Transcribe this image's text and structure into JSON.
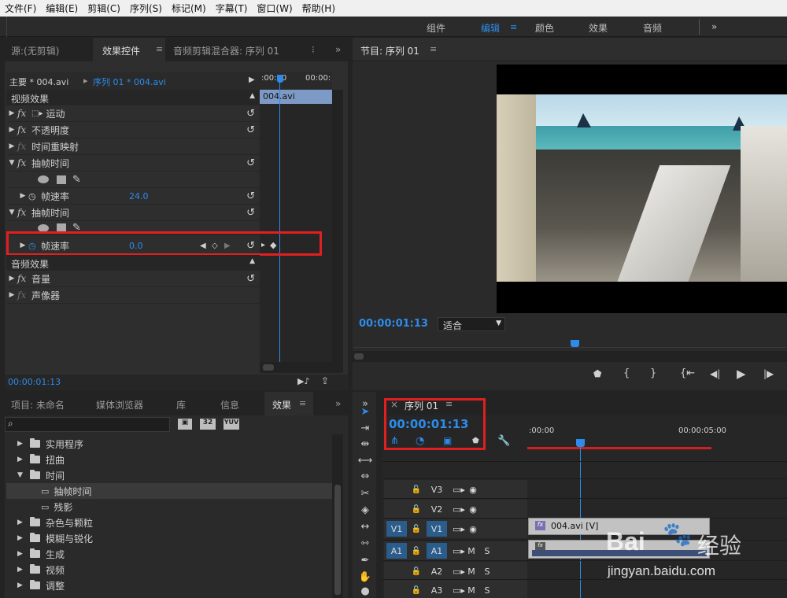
{
  "menu": [
    "文件(F)",
    "编辑(E)",
    "剪辑(C)",
    "序列(S)",
    "标记(M)",
    "字幕(T)",
    "窗口(W)",
    "帮助(H)"
  ],
  "workspaces": {
    "items": [
      "组件",
      "编辑",
      "颜色",
      "效果",
      "音频"
    ],
    "active": "编辑",
    "more": "»"
  },
  "effect_panel": {
    "tabs": [
      "源:(无剪辑)",
      "效果控件",
      "音频剪辑混合器: 序列 01"
    ],
    "master": "主要 * 004.avi",
    "sequence": "序列 01 * 004.avi",
    "ruler": [
      ":00:00",
      "00:00:"
    ],
    "clip_label": "004.avi",
    "video_section": "视频效果",
    "audio_section": "音频效果",
    "rows": {
      "motion": "运动",
      "opacity": "不透明度",
      "time_remap": "时间重映射",
      "posterize1": "抽帧时间",
      "framerate1": "帧速率",
      "framerate1_value": "24.0",
      "posterize2": "抽帧时间",
      "framerate2": "帧速率",
      "framerate2_value": "0.0",
      "volume": "音量",
      "panner": "声像器"
    },
    "timecode": "00:00:01:13"
  },
  "program": {
    "title": "节目: 序列 01",
    "timecode": "00:00:01:13",
    "fit": "适合"
  },
  "project_panel": {
    "tabs": [
      "项目: 未命名",
      "媒体浏览器",
      "库",
      "信息",
      "效果"
    ],
    "icon_labels": [
      "32",
      "YUV"
    ],
    "tree": [
      {
        "label": "实用程序",
        "level": 1,
        "type": "folder",
        "open": false
      },
      {
        "label": "扭曲",
        "level": 1,
        "type": "folder",
        "open": false
      },
      {
        "label": "时间",
        "level": 1,
        "type": "folder",
        "open": true
      },
      {
        "label": "抽帧时间",
        "level": 2,
        "type": "effect",
        "selected": true
      },
      {
        "label": "残影",
        "level": 2,
        "type": "effect"
      },
      {
        "label": "杂色与颗粒",
        "level": 1,
        "type": "folder",
        "open": false
      },
      {
        "label": "模糊与锐化",
        "level": 1,
        "type": "folder",
        "open": false
      },
      {
        "label": "生成",
        "level": 1,
        "type": "folder",
        "open": false
      },
      {
        "label": "视频",
        "level": 1,
        "type": "folder",
        "open": false
      },
      {
        "label": "调整",
        "level": 1,
        "type": "folder",
        "open": false
      }
    ]
  },
  "timeline": {
    "close": "×",
    "title": "序列 01",
    "timecode": "00:00:01:13",
    "ruler": [
      ":00:00",
      "00:00:05:00"
    ],
    "tracks": [
      {
        "name": "V3",
        "source": "",
        "kind": "video"
      },
      {
        "name": "V2",
        "source": "",
        "kind": "video"
      },
      {
        "name": "V1",
        "source": "V1",
        "kind": "video"
      },
      {
        "name": "A1",
        "source": "A1",
        "kind": "audio"
      },
      {
        "name": "A2",
        "source": "",
        "kind": "audio"
      },
      {
        "name": "A3",
        "source": "",
        "kind": "audio"
      }
    ],
    "audio_btns": [
      "M",
      "S"
    ],
    "video_clip": "004.avi [V]"
  },
  "watermark": {
    "brand": "Bai",
    "brand2": "经验",
    "url": "jingyan.baidu.com"
  },
  "colors": {
    "accent": "#2d8ceb",
    "highlight": "#e02020",
    "bg": "#232323",
    "panel": "#2e2e2e"
  }
}
